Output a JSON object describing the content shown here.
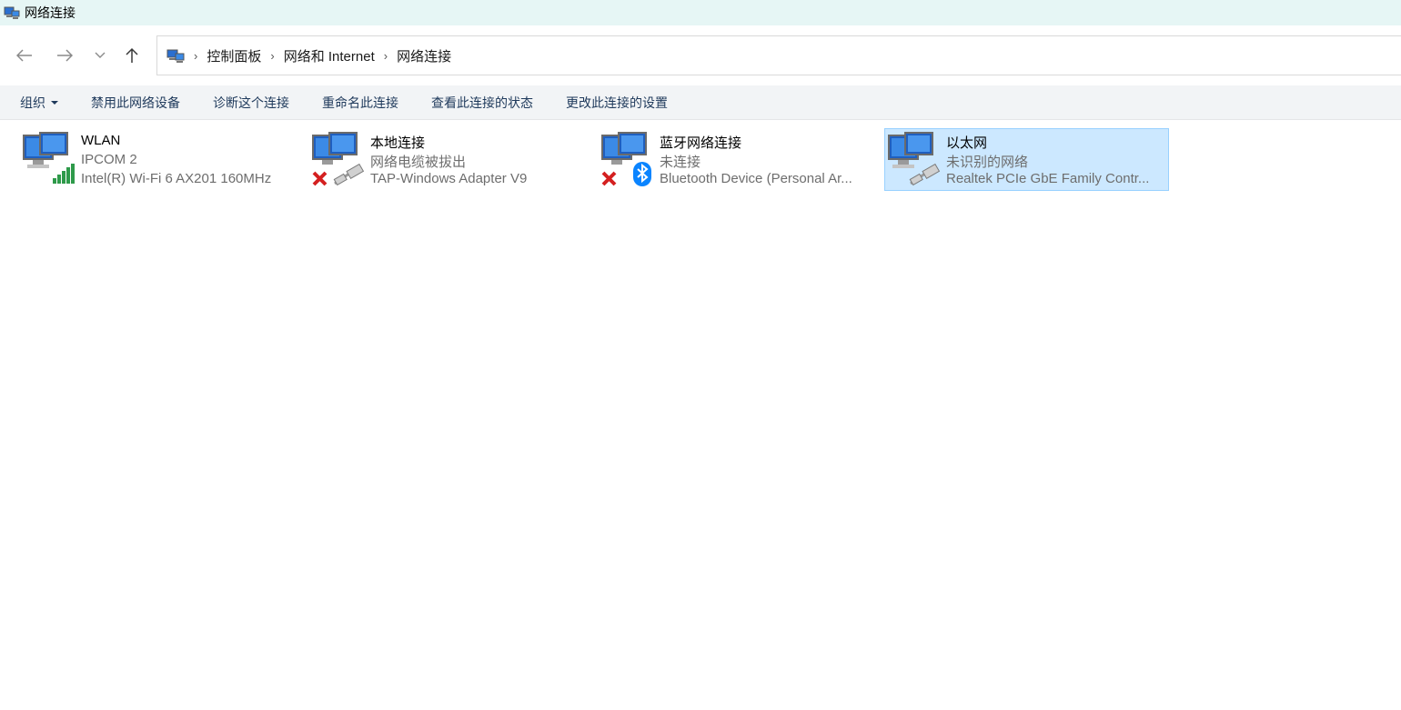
{
  "window": {
    "title": "网络连接"
  },
  "nav": {
    "back_icon": "arrow-left-icon",
    "forward_icon": "arrow-right-icon",
    "recent_icon": "chevron-down-icon",
    "up_icon": "arrow-up-icon"
  },
  "address": {
    "crumbs": [
      "控制面板",
      "网络和 Internet",
      "网络连接"
    ]
  },
  "commands": {
    "organize": "组织",
    "disable": "禁用此网络设备",
    "diagnose": "诊断这个连接",
    "rename": "重命名此连接",
    "status": "查看此连接的状态",
    "settings": "更改此连接的设置"
  },
  "connections": [
    {
      "name": "WLAN",
      "status": "IPCOM 2",
      "device": "Intel(R) Wi-Fi 6 AX201 160MHz",
      "overlay": "wifi-signal-icon",
      "disabled": false,
      "selected": false
    },
    {
      "name": "本地连接",
      "status": "网络电缆被拔出",
      "device": "TAP-Windows Adapter V9",
      "overlay": "ethernet-cable-icon",
      "disabled": true,
      "selected": false
    },
    {
      "name": "蓝牙网络连接",
      "status": "未连接",
      "device": "Bluetooth Device (Personal Ar...",
      "overlay": "bluetooth-icon",
      "disabled": true,
      "selected": false
    },
    {
      "name": "以太网",
      "status": "未识别的网络",
      "device": "Realtek PCIe GbE Family Contr...",
      "overlay": "ethernet-cable-icon",
      "disabled": false,
      "selected": true
    }
  ],
  "colors": {
    "selection": "#cce8ff",
    "selection_border": "#99d1ff",
    "titlebar": "#e6f6f5",
    "command_text": "#1e395b"
  }
}
